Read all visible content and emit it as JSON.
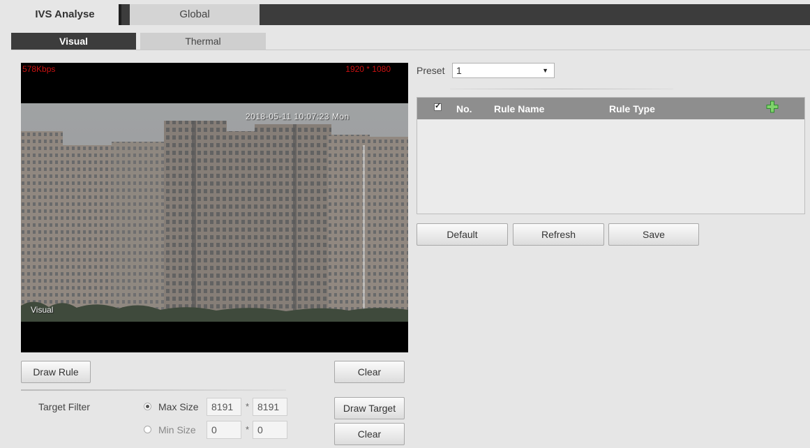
{
  "tabs": {
    "main": "IVS Analyse",
    "global": "Global"
  },
  "subtabs": {
    "visual": "Visual",
    "thermal": "Thermal"
  },
  "video": {
    "bitrate": "578Kbps",
    "resolution": "1920 * 1080",
    "timestamp": "2018-05-11 10:07:23 Mon",
    "channel": "Visual"
  },
  "buttons": {
    "draw_rule": "Draw Rule",
    "clear": "Clear",
    "draw_target": "Draw Target",
    "clear_target": "Clear",
    "default": "Default",
    "refresh": "Refresh",
    "save": "Save"
  },
  "target_filter": {
    "label": "Target Filter",
    "max_label": "Max Size",
    "max_w": "8191",
    "max_h": "8191",
    "min_label": "Min Size",
    "min_w": "0",
    "min_h": "0",
    "separator": "*",
    "selected": "Max Size"
  },
  "preset": {
    "label": "Preset",
    "value": "1"
  },
  "rule_table": {
    "columns": [
      "No.",
      "Rule Name",
      "Rule Type"
    ],
    "rows": []
  },
  "icons": {
    "add": "add-icon",
    "checkbox": "checkbox-icon",
    "dropdown": "dropdown-arrow-icon"
  }
}
